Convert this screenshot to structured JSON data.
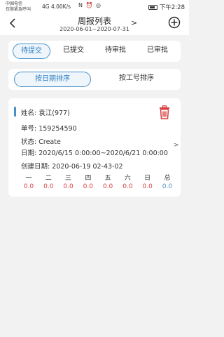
{
  "status_bar": {
    "carrier_line1": "中国电信",
    "carrier_line2": "仅限紧急呼叫",
    "network": "4G",
    "speed": "4.00K/s",
    "icons": "N ⏰ ◎",
    "time": "下午2:28"
  },
  "header": {
    "title": "周报列表",
    "date_range": "2020-06-01~2020-07-31",
    "next_symbol": ">"
  },
  "tabs": [
    {
      "label": "待提交",
      "active": true
    },
    {
      "label": "已提交",
      "active": false
    },
    {
      "label": "待审批",
      "active": false
    },
    {
      "label": "已审批",
      "active": false
    }
  ],
  "sort": [
    {
      "label": "按日期排序",
      "active": true
    },
    {
      "label": "按工号排序",
      "active": false
    }
  ],
  "card": {
    "name_label": "姓名:",
    "name_value": "袁江(977)",
    "number_label": "单号:",
    "number_value": "159254590",
    "status_label": "状态:",
    "status_value": "Create",
    "date_label": "日期:",
    "date_value": "2020/6/15 0:00:00~2020/6/21 0:00:00",
    "created_label": "创建日期:",
    "created_value": "2020-06-19 02-43-02",
    "chevron": ">",
    "days": [
      {
        "label": "一",
        "value": "0.0"
      },
      {
        "label": "二",
        "value": "0.0"
      },
      {
        "label": "三",
        "value": "0.0"
      },
      {
        "label": "四",
        "value": "0.0"
      },
      {
        "label": "五",
        "value": "0.0"
      },
      {
        "label": "六",
        "value": "0.0"
      },
      {
        "label": "日",
        "value": "0.0"
      },
      {
        "label": "总",
        "value": "0.0"
      }
    ]
  },
  "colors": {
    "accent": "#4a90c8",
    "value_red": "#d94040",
    "delete_red": "#d63c3c"
  }
}
